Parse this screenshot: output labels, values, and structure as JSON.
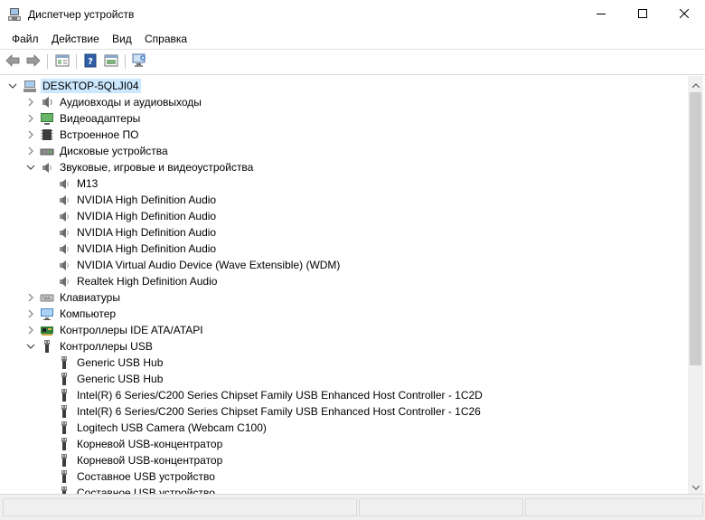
{
  "window": {
    "title": "Диспетчер устройств",
    "icon": "device-manager-icon",
    "buttons": [
      "minimize",
      "maximize",
      "close"
    ]
  },
  "menu": [
    "Файл",
    "Действие",
    "Вид",
    "Справка"
  ],
  "toolbar": [
    "back-icon",
    "forward-icon",
    "properties-icon",
    "help-icon",
    "update-driver-icon",
    "scan-hardware-icon"
  ],
  "tree": {
    "root": "DESKTOP-5QLJI04",
    "rows": [
      {
        "label": "Аудиовходы и аудиовыходы",
        "level": 1,
        "icon": "audio-io-icon",
        "expanded": false
      },
      {
        "label": "Видеоадаптеры",
        "level": 1,
        "icon": "display-adapter-icon",
        "expanded": false
      },
      {
        "label": "Встроенное ПО",
        "level": 1,
        "icon": "firmware-icon",
        "expanded": false
      },
      {
        "label": "Дисковые устройства",
        "level": 1,
        "icon": "disk-drive-icon",
        "expanded": false
      },
      {
        "label": "Звуковые, игровые и видеоустройства",
        "level": 1,
        "icon": "speaker-icon",
        "expanded": true
      },
      {
        "label": "M13",
        "level": 2,
        "icon": "speaker-icon"
      },
      {
        "label": "NVIDIA High Definition Audio",
        "level": 2,
        "icon": "speaker-icon"
      },
      {
        "label": "NVIDIA High Definition Audio",
        "level": 2,
        "icon": "speaker-icon"
      },
      {
        "label": "NVIDIA High Definition Audio",
        "level": 2,
        "icon": "speaker-icon"
      },
      {
        "label": "NVIDIA High Definition Audio",
        "level": 2,
        "icon": "speaker-icon"
      },
      {
        "label": "NVIDIA Virtual Audio Device (Wave Extensible) (WDM)",
        "level": 2,
        "icon": "speaker-icon"
      },
      {
        "label": "Realtek High Definition Audio",
        "level": 2,
        "icon": "speaker-icon"
      },
      {
        "label": "Клавиатуры",
        "level": 1,
        "icon": "keyboard-icon",
        "expanded": false
      },
      {
        "label": "Компьютер",
        "level": 1,
        "icon": "computer-icon",
        "expanded": false
      },
      {
        "label": "Контроллеры IDE ATA/ATAPI",
        "level": 1,
        "icon": "ide-controller-icon",
        "expanded": false
      },
      {
        "label": "Контроллеры USB",
        "level": 1,
        "icon": "usb-icon",
        "expanded": true
      },
      {
        "label": "Generic USB Hub",
        "level": 2,
        "icon": "usb-icon"
      },
      {
        "label": "Generic USB Hub",
        "level": 2,
        "icon": "usb-icon"
      },
      {
        "label": "Intel(R) 6 Series/C200 Series Chipset Family USB Enhanced Host Controller - 1C2D",
        "level": 2,
        "icon": "usb-icon"
      },
      {
        "label": "Intel(R) 6 Series/C200 Series Chipset Family USB Enhanced Host Controller - 1C26",
        "level": 2,
        "icon": "usb-icon"
      },
      {
        "label": "Logitech USB Camera (Webcam C100)",
        "level": 2,
        "icon": "usb-icon"
      },
      {
        "label": "Корневой USB-концентратор",
        "level": 2,
        "icon": "usb-icon"
      },
      {
        "label": "Корневой USB-концентратор",
        "level": 2,
        "icon": "usb-icon"
      },
      {
        "label": "Составное USB устройство",
        "level": 2,
        "icon": "usb-icon"
      },
      {
        "label": "Составное USB устройство",
        "level": 2,
        "icon": "usb-icon"
      }
    ]
  },
  "colors": {
    "selection": "#cce8ff",
    "accent": "#0078d7",
    "chrome": "#f0f0f0"
  }
}
